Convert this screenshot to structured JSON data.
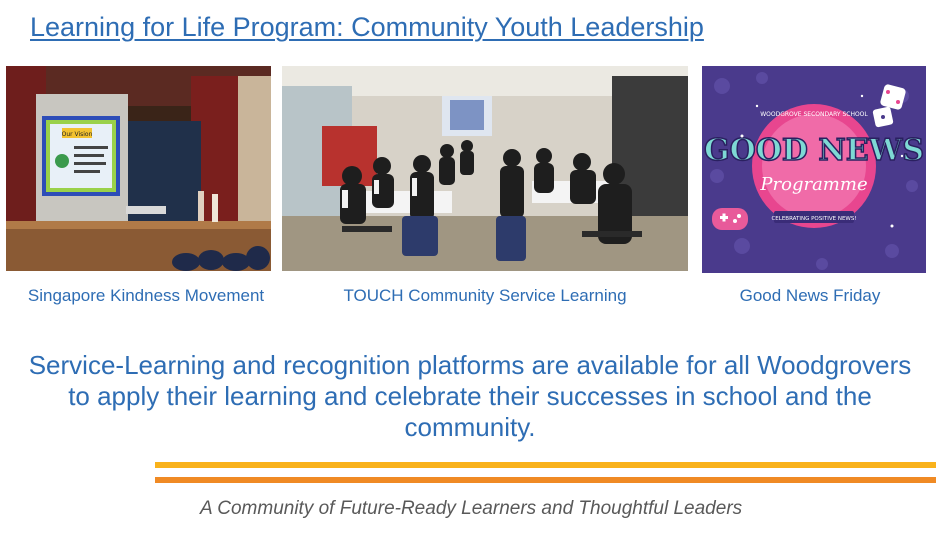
{
  "header": {
    "title": "Learning for Life Program: Community Youth Leadership"
  },
  "photos": [
    {
      "caption": "Singapore Kindness Movement",
      "slide_heading": "Our Vision"
    },
    {
      "caption": "TOUCH Community Service Learning"
    },
    {
      "caption": "Good News Friday",
      "poster": {
        "arc_text": "WOODGROVE SECONDARY SCHOOL",
        "headline": "GOOD NEWS",
        "script_word": "Programme",
        "ribbon_text": "CELEBRATING POSITIVE NEWS!"
      }
    }
  ],
  "statement": "Service-Learning and recognition platforms are available for all Woodgrovers to apply their learning and celebrate their successes in school and the community.",
  "tagline": "A Community of Future-Ready Learners and Thoughtful Leaders",
  "colors": {
    "title_blue": "#2e6db4",
    "bar_yellow": "#f9b21b",
    "bar_orange": "#f08a24",
    "poster_purple": "#4a3a8c",
    "poster_pink": "#e8468f"
  }
}
